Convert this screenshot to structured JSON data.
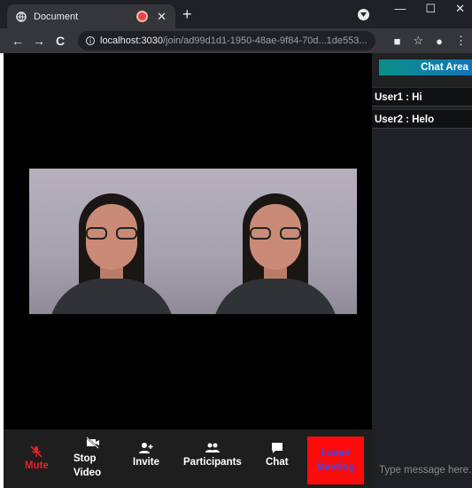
{
  "browser": {
    "tab_title": "Document",
    "tab_close": "✕",
    "new_tab": "+",
    "window_controls": [
      "—",
      "☐",
      "✕"
    ],
    "url_host": "localhost:3030",
    "url_path": "/join/ad99d1d1-1950-48ae-9f84-70d...1de553...",
    "nav": {
      "back": "←",
      "forward": "→",
      "reload": "C"
    },
    "toolbar_icons": {
      "camera": "■",
      "star": "☆",
      "profile": "●",
      "menu": "⋮"
    }
  },
  "meeting": {
    "controls": {
      "mute": "Mute",
      "stop_video_line1": "Stop",
      "stop_video_line2": "Video",
      "invite": "Invite",
      "participants": "Participants",
      "chat": "Chat",
      "leave_line1": "Leave",
      "leave_line2": "Meeting"
    },
    "colors": {
      "mute": "#e8202a",
      "leave_bg": "#ff0a0a",
      "leave_text": "#2d4bff"
    }
  },
  "chat": {
    "header": "Chat Area",
    "messages": [
      {
        "text": "User1 : Hi"
      },
      {
        "text": "User2 : Helo"
      }
    ],
    "input_placeholder": "Type message here..."
  }
}
